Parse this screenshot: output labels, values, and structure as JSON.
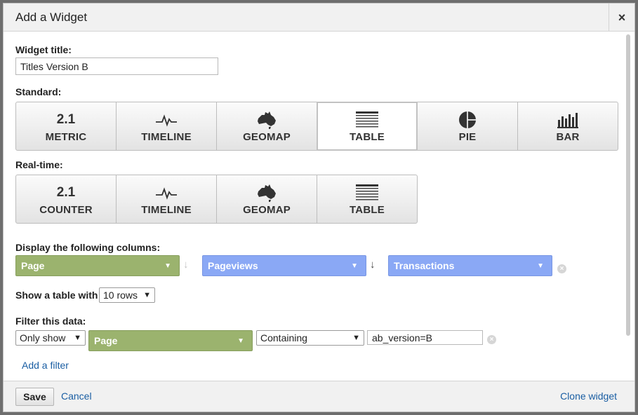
{
  "dialog": {
    "title": "Add a Widget",
    "close_label": "×"
  },
  "widget_title": {
    "label": "Widget title:",
    "value": "Titles Version B"
  },
  "standard": {
    "label": "Standard:",
    "options": [
      {
        "icon_text": "2.1",
        "label": "METRIC",
        "selected": false
      },
      {
        "icon": "timeline-icon",
        "label": "TIMELINE",
        "selected": false
      },
      {
        "icon": "australia-map-icon",
        "label": "GEOMAP",
        "selected": false
      },
      {
        "icon": "table-lines-icon",
        "label": "TABLE",
        "selected": true
      },
      {
        "icon": "pie-chart-icon",
        "label": "PIE",
        "selected": false
      },
      {
        "icon": "bar-chart-icon",
        "label": "BAR",
        "selected": false
      }
    ]
  },
  "realtime": {
    "label": "Real-time:",
    "options": [
      {
        "icon_text": "2.1",
        "label": "COUNTER"
      },
      {
        "icon": "timeline-icon",
        "label": "TIMELINE"
      },
      {
        "icon": "australia-map-icon",
        "label": "GEOMAP"
      },
      {
        "icon": "table-lines-icon",
        "label": "TABLE"
      }
    ]
  },
  "columns": {
    "label": "Display the following columns:",
    "items": [
      {
        "label": "Page",
        "color": "#9bb36e"
      },
      {
        "label": "Pageviews",
        "color": "#8aa8f5"
      },
      {
        "label": "Transactions",
        "color": "#8aa8f5"
      }
    ],
    "sort_arrow": "↓"
  },
  "table_rows": {
    "label": "Show a table with",
    "value": "10 rows"
  },
  "filter": {
    "label": "Filter this data:",
    "mode": "Only show",
    "dimension": "Page",
    "match": "Containing",
    "value": "ab_version=B",
    "add_label": "Add a filter"
  },
  "footer": {
    "save": "Save",
    "cancel": "Cancel",
    "clone": "Clone widget"
  },
  "icons": {
    "dropdown": "▼",
    "remove": "×"
  }
}
